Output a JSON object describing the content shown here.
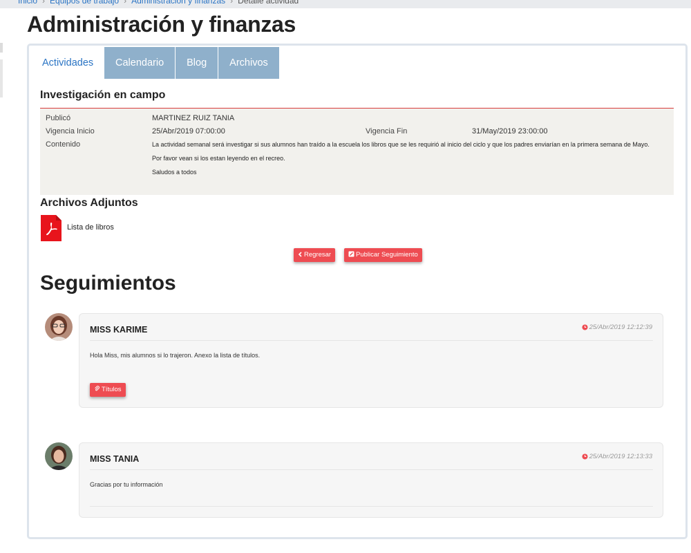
{
  "breadcrumb": {
    "items": [
      "Inicio",
      "Equipos de trabajo",
      "Administración y finanzas",
      "Detalle actividad"
    ]
  },
  "page_title": "Administración y finanzas",
  "tabs": [
    {
      "label": "Actividades",
      "active": true
    },
    {
      "label": "Calendario",
      "active": false
    },
    {
      "label": "Blog",
      "active": false
    },
    {
      "label": "Archivos",
      "active": false
    }
  ],
  "activity": {
    "title": "Investigación en campo",
    "published_label": "Publicó",
    "published_value": "MARTINEZ RUIZ TANIA",
    "start_label": "Vigencia Inicio",
    "start_value": "25/Abr/2019 07:00:00",
    "end_label": "Vigencia Fin",
    "end_value": "31/May/2019 23:00:00",
    "content_label": "Contenido",
    "content": [
      "La actividad semanal será investigar si sus alumnos han traído a la escuela los libros que se les requirió al inicio del ciclo y que los padres enviarían en la primera semana de Mayo.",
      "Por favor vean si los estan leyendo en el recreo.",
      "Saludos a todos"
    ]
  },
  "attachments": {
    "title": "Archivos Adjuntos",
    "items": [
      {
        "name": "Lista de libros",
        "icon": "pdf-icon"
      }
    ]
  },
  "actions": {
    "back_label": "Regresar",
    "publish_label": "Publicar Seguimiento"
  },
  "followups": {
    "title": "Seguimientos",
    "items": [
      {
        "author": "MISS KARIME",
        "timestamp": "25/Abr/2019 12:12:39",
        "message": "Hola Miss, mis alumnos si lo trajeron. Anexo la lista de títulos.",
        "attachment_label": "Títulos"
      },
      {
        "author": "MISS TANIA",
        "timestamp": "25/Abr/2019 12:13:33",
        "message": "Gracias por tu información"
      }
    ]
  },
  "colors": {
    "accent_red": "#ee4c52",
    "tab_blue": "#8fb0cb",
    "link_blue": "#2a74c4",
    "info_bg": "#f2f1ed",
    "pdf_red": "#e8141c"
  }
}
